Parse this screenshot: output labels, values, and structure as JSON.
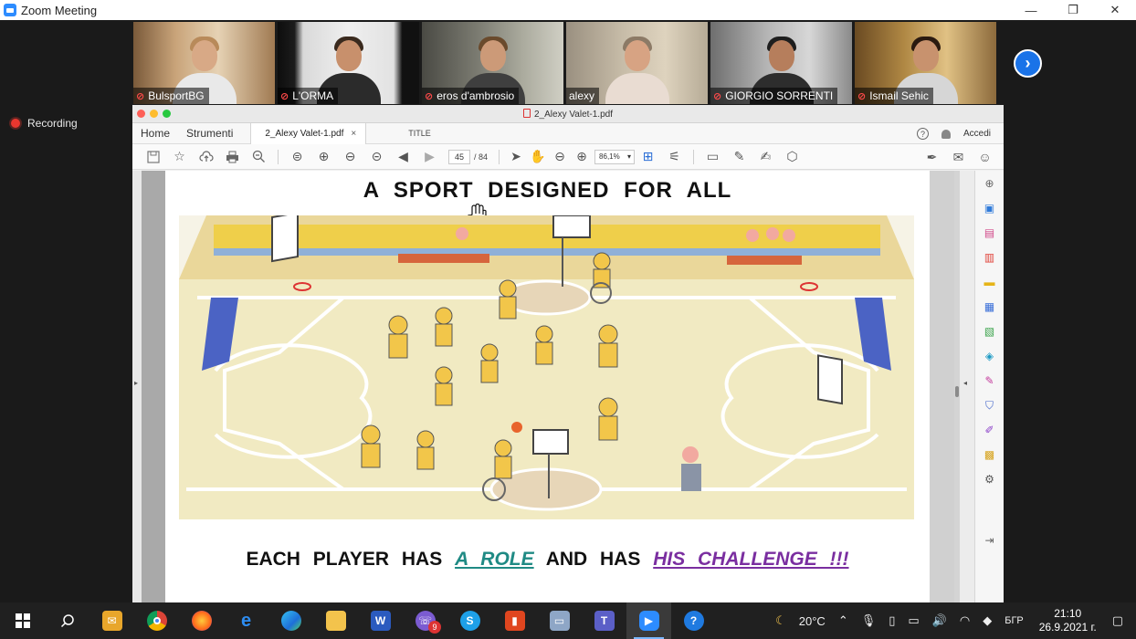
{
  "window": {
    "title": "Zoom Meeting",
    "minimize_glyph": "—",
    "restore_glyph": "❐",
    "close_glyph": "✕"
  },
  "participants": [
    {
      "name": "BulsportBG",
      "active": false
    },
    {
      "name": "L'ORMA",
      "active": false
    },
    {
      "name": "eros d'ambrosio",
      "active": false
    },
    {
      "name": "alexy",
      "active": true
    },
    {
      "name": "GIORGIO SORRENTI",
      "active": false
    },
    {
      "name": "Ismail Sehic",
      "active": false
    }
  ],
  "gallery_next_glyph": "›",
  "recording": {
    "label": "Recording"
  },
  "shared": {
    "doc_title": "2_Alexy Valet-1.pdf",
    "menu": {
      "home": "Home",
      "tools": "Strumenti"
    },
    "tabs": [
      {
        "label": "2_Alexy Valet-1.pdf",
        "close": "×"
      },
      {
        "label": "TITLE"
      }
    ],
    "signin": "Accedi",
    "help_glyph": "?",
    "page": {
      "current": "45",
      "separator": "/",
      "total": "84"
    },
    "zoom": "86,1%",
    "pdf": {
      "title": "A SPORT DESIGNED FOR ALL",
      "caption_before": "EACH PLAYER HAS",
      "caption_role": "A ROLE",
      "caption_middle": "AND HAS",
      "caption_challenge": "HIS CHALLENGE !!!"
    },
    "colors": {
      "role": "#1f8a84",
      "challenge": "#7a2ea0"
    }
  },
  "taskbar": {
    "weather": "20°C",
    "lang": "БГР",
    "time": "21:10",
    "date": "26.9.2021 г.",
    "teams_badge": "9"
  }
}
